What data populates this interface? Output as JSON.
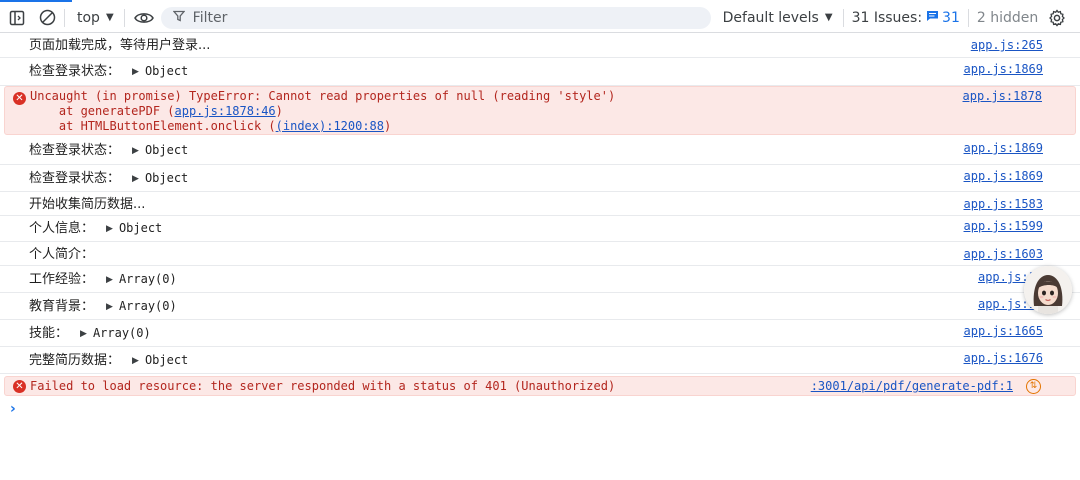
{
  "toolbar": {
    "context": "top",
    "filter_placeholder": "Filter",
    "levels": "Default levels",
    "issues_label": "31 Issues:",
    "issues_count": "31",
    "hidden": "2 hidden"
  },
  "logs": [
    {
      "text": "页面加载完成，等待用户登录...",
      "source": "app.js:265"
    },
    {
      "text": "检查登录状态：",
      "obj": "Object",
      "source": "app.js:1869"
    },
    {
      "error": true,
      "line1": "Uncaught (in promise) TypeError: Cannot read properties of null (reading 'style')",
      "line2_pre": "    at generatePDF (",
      "line2_link": "app.js:1878:46",
      "line2_post": ")",
      "line3_pre": "    at HTMLButtonElement.onclick (",
      "line3_link": "(index):1200:88",
      "line3_post": ")",
      "source": "app.js:1878"
    },
    {
      "text": "检查登录状态：",
      "obj": "Object",
      "source": "app.js:1869"
    },
    {
      "text": "检查登录状态：",
      "obj": "Object",
      "source": "app.js:1869"
    },
    {
      "text": "开始收集简历数据...",
      "source": "app.js:1583"
    },
    {
      "text": "个人信息：",
      "obj": "Object",
      "source": "app.js:1599"
    },
    {
      "text": "个人简介：",
      "source": "app.js:1603"
    },
    {
      "text": "工作经验：",
      "obj": "Array(0)",
      "source": "app.js:16"
    },
    {
      "text": "教育背景：",
      "obj": "Array(0)",
      "source": "app.js:16"
    },
    {
      "text": "技能：",
      "obj": "Array(0)",
      "source": "app.js:1665"
    },
    {
      "text": "完整简历数据：",
      "obj": "Object",
      "source": "app.js:1676"
    },
    {
      "error": true,
      "line1": "Failed to load resource: the server responded with a status of 401 (Unauthorized)",
      "source": ":3001/api/pdf/generate-pdf:1"
    }
  ],
  "prompt": "›",
  "icons": {
    "error": "x-circle-icon",
    "network": "network-request-icon"
  }
}
